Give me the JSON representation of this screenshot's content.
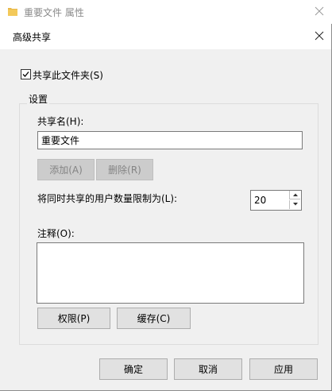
{
  "parent_window": {
    "title": "重要文件 属性",
    "icon": "folder-icon"
  },
  "dialog": {
    "title": "高级共享",
    "close_icon": "close-icon"
  },
  "share_checkbox": {
    "label": "共享此文件夹(S)",
    "checked": true
  },
  "settings_group": {
    "legend": "设置",
    "share_name_label": "共享名(H):",
    "share_name_value": "重要文件",
    "add_button": "添加(A)",
    "remove_button": "删除(R)",
    "user_limit_label": "将同时共享的用户数量限制为(L):",
    "user_limit_value": "20",
    "comments_label": "注释(O):",
    "comments_value": "",
    "permissions_button": "权限(P)",
    "caching_button": "缓存(C)"
  },
  "footer": {
    "ok_button": "确定",
    "cancel_button": "取消",
    "apply_button": "应用"
  },
  "colors": {
    "window_bg": "#f0f0f0",
    "titlebar_bg": "#ffffff",
    "button_bg": "#e1e1e1",
    "disabled_button_bg": "#cccccc",
    "folder_yellow": "#e8b84a"
  }
}
